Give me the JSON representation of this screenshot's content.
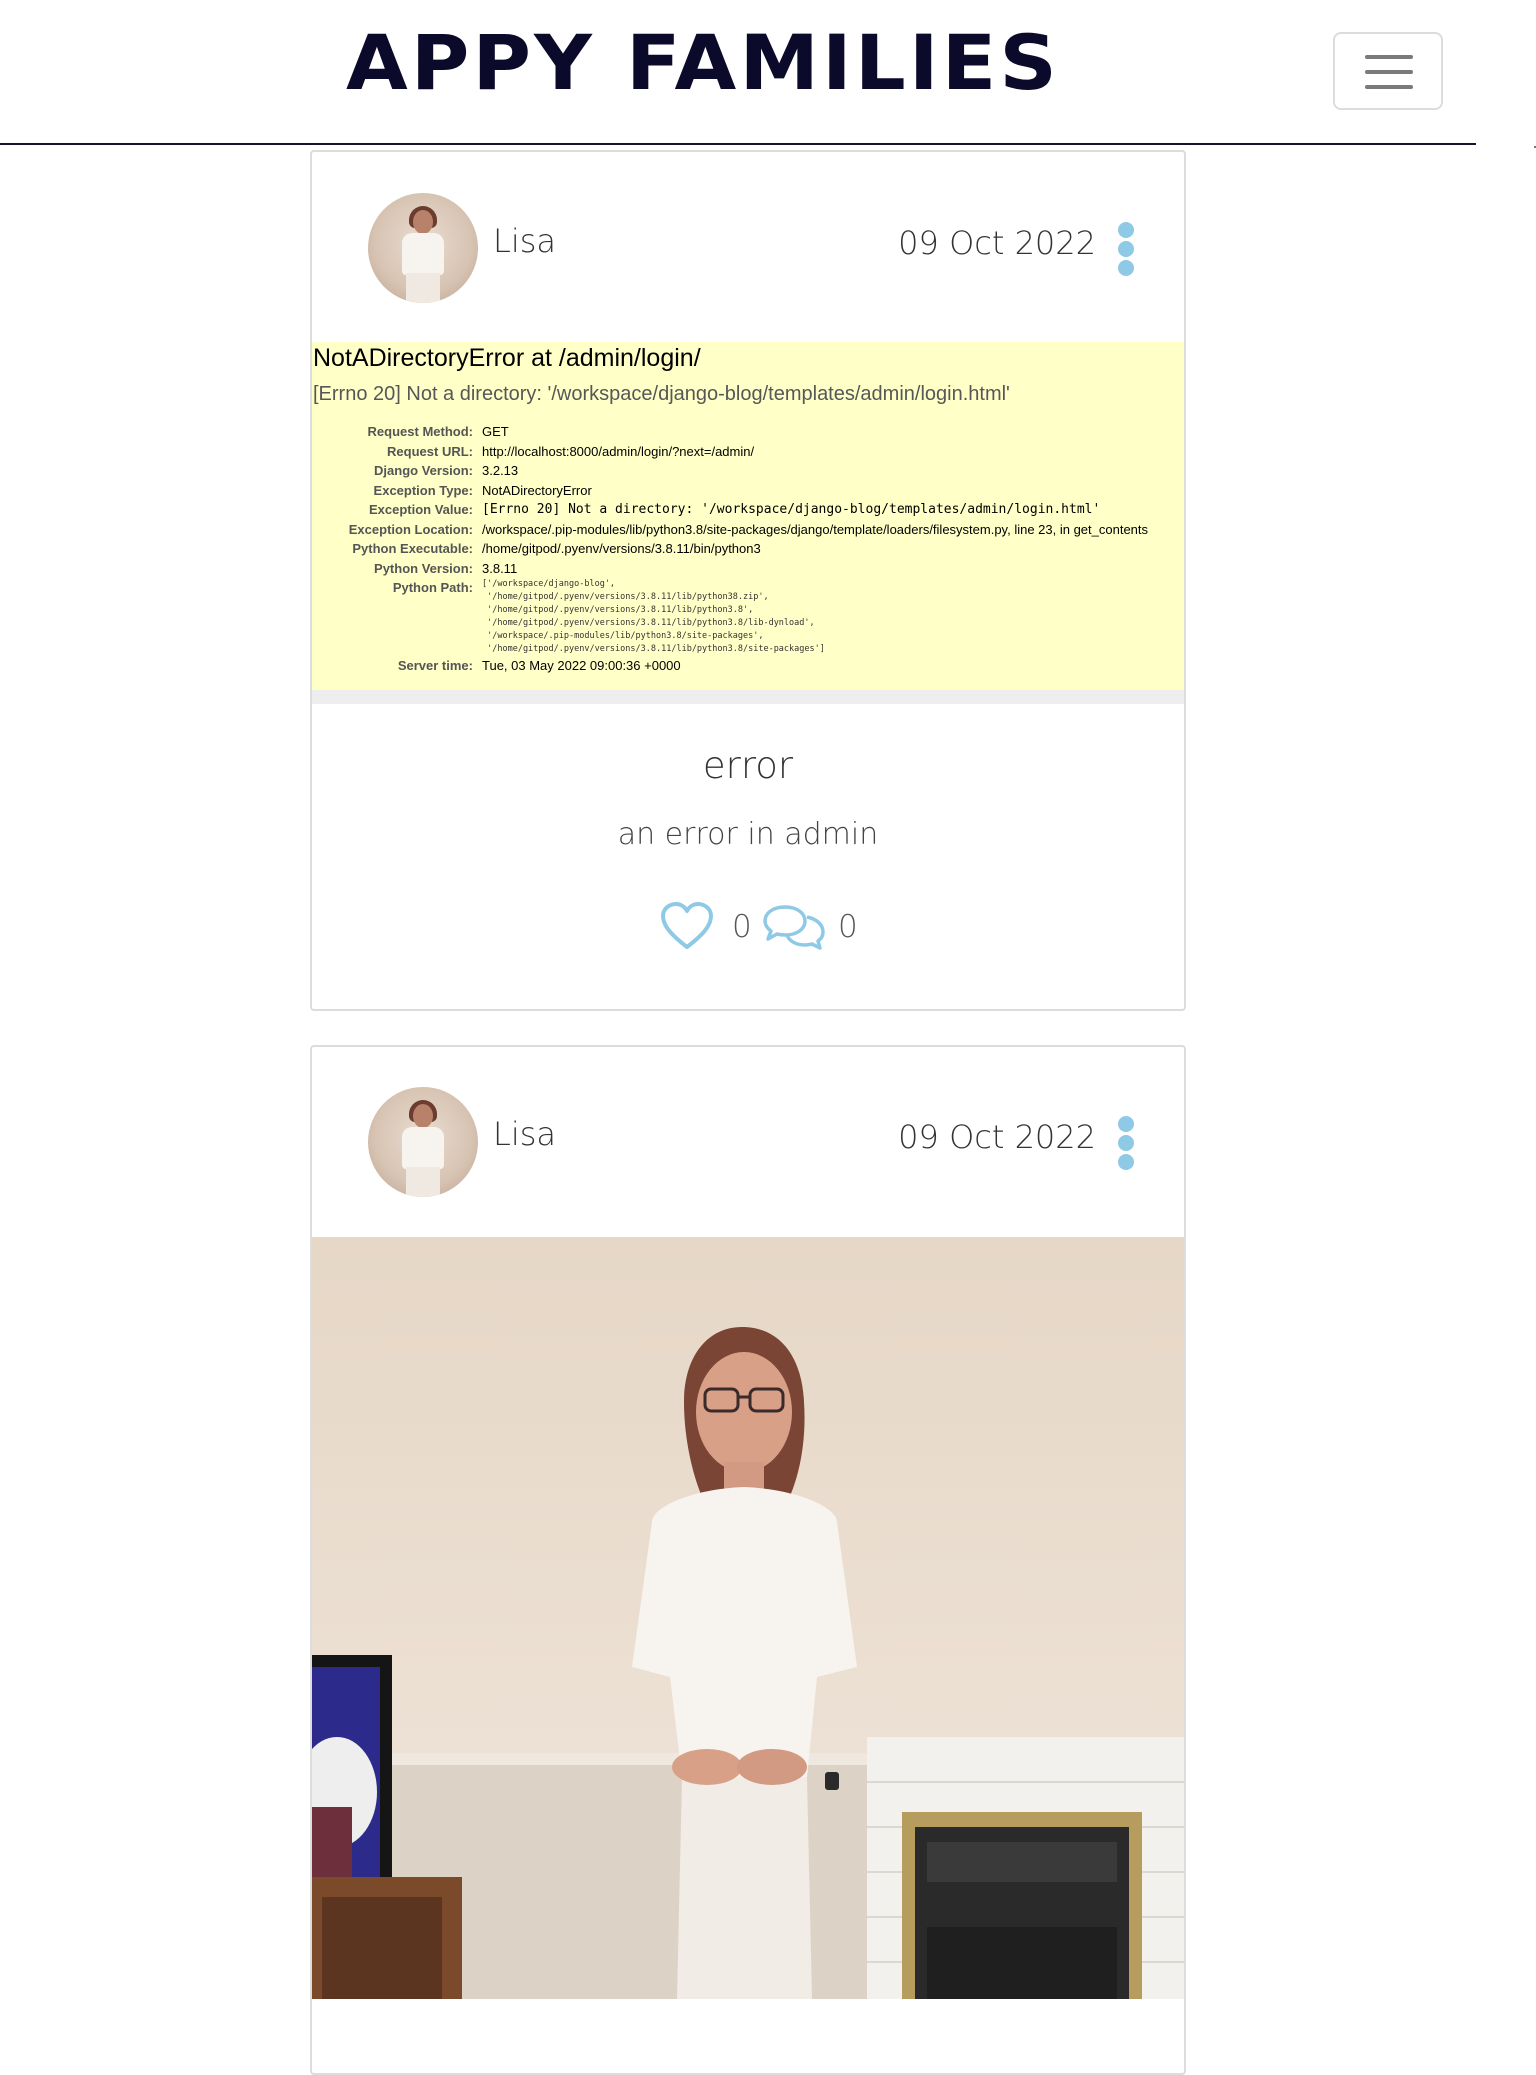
{
  "header": {
    "brand": "APPY FAMILIES",
    "menu_toggle": "menu-toggle"
  },
  "posts": [
    {
      "author": "Lisa",
      "date": "09 Oct 2022",
      "image": {
        "kind": "error-screenshot",
        "title": "NotADirectoryError at /admin/login/",
        "subtitle": "[Errno 20] Not a directory: '/workspace/django-blog/templates/admin/login.html'",
        "rows": [
          {
            "label": "Request Method:",
            "value": "GET"
          },
          {
            "label": "Request URL:",
            "value": "http://localhost:8000/admin/login/?next=/admin/"
          },
          {
            "label": "Django Version:",
            "value": "3.2.13"
          },
          {
            "label": "Exception Type:",
            "value": "NotADirectoryError"
          },
          {
            "label": "Exception Value:",
            "value": "[Errno 20] Not a directory: '/workspace/django-blog/templates/admin/login.html'"
          },
          {
            "label": "Exception Location:",
            "value": "/workspace/.pip-modules/lib/python3.8/site-packages/django/template/loaders/filesystem.py, line 23, in get_contents"
          },
          {
            "label": "Python Executable:",
            "value": "/home/gitpod/.pyenv/versions/3.8.11/bin/python3"
          },
          {
            "label": "Python Version:",
            "value": "3.8.11"
          },
          {
            "label": "Python Path:",
            "value": "['/workspace/django-blog',\n '/home/gitpod/.pyenv/versions/3.8.11/lib/python38.zip',\n '/home/gitpod/.pyenv/versions/3.8.11/lib/python3.8',\n '/home/gitpod/.pyenv/versions/3.8.11/lib/python3.8/lib-dynload',\n '/workspace/.pip-modules/lib/python3.8/site-packages',\n '/home/gitpod/.pyenv/versions/3.8.11/lib/python3.8/site-packages']"
          },
          {
            "label": "Server time:",
            "value": "Tue, 03 May 2022 09:00:36 +0000"
          }
        ]
      },
      "title": "error",
      "excerpt": "an error in admin",
      "likes": "0",
      "comments": "0"
    },
    {
      "author": "Lisa",
      "date": "09 Oct 2022",
      "image": {
        "kind": "photo"
      }
    }
  ],
  "colors": {
    "accent": "#8ec9e5",
    "brand": "#0c0a2a",
    "error_bg": "#ffffc8"
  },
  "icons": [
    "hamburger-icon",
    "kebab-icon",
    "heart-icon",
    "comments-icon"
  ]
}
